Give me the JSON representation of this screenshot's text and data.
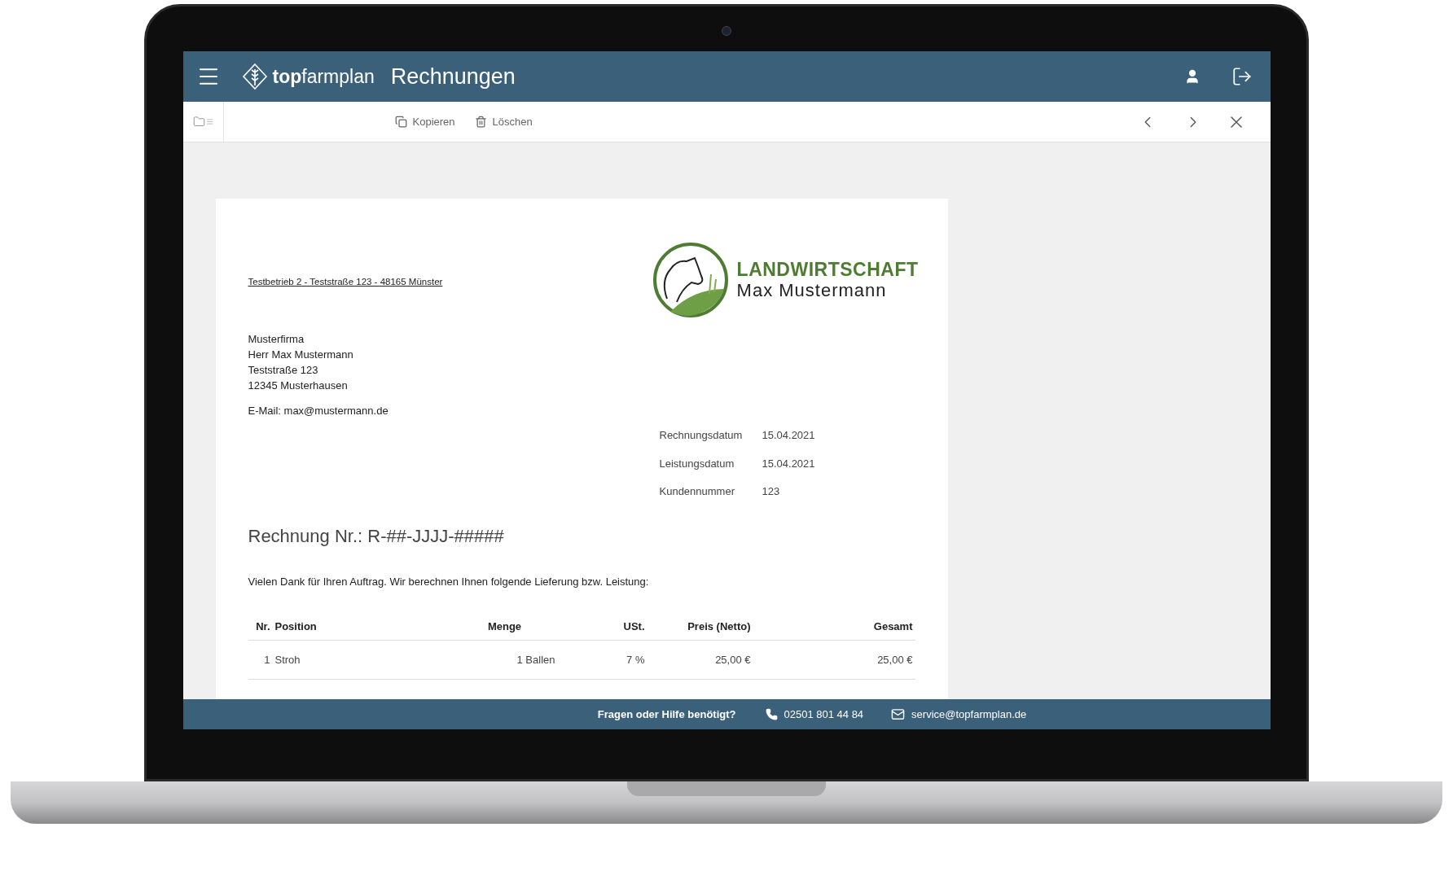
{
  "header": {
    "app_name": "**top**farmplan",
    "title": "Rechnungen"
  },
  "toolbar": {
    "actions": [
      {
        "label": "Kopieren",
        "kind": "copy"
      },
      {
        "label": "Löschen",
        "kind": "delete"
      }
    ]
  },
  "document": {
    "sender_line": "Testbetrieb 2 - Teststraße 123 - 48165 Münster",
    "logo": {
      "line_1": "LANDWIRTSCHAFT",
      "line_2": "Max Mustermann"
    },
    "recipient": [
      "Musterfirma",
      "Herr Max Mustermann",
      "Teststraße 123",
      "12345 Musterhausen"
    ],
    "email": "E-Mail: max@mustermann.de",
    "meta": [
      {
        "label": "Rechnungsdatum",
        "value": "15.04.2021"
      },
      {
        "label": "Leistungsdatum",
        "value": "15.04.2021"
      },
      {
        "label": "Kundennummer",
        "value": "123"
      }
    ],
    "title": "Rechnung Nr.: R-##-JJJJ-#####",
    "intro": "Vielen Dank für Ihren Auftrag. Wir berechnen Ihnen folgende Lieferung bzw. Leistung:",
    "table": {
      "columns": [
        "Nr.",
        "Position",
        "Menge",
        "USt.",
        "Preis (Netto)",
        "Gesamt"
      ],
      "rows": [
        [
          "1",
          "Stroh",
          "1 Ballen",
          "7 %",
          "25,00 €",
          "25,00 €"
        ]
      ]
    }
  },
  "footer": {
    "question": "Fragen oder Hilfe benötigt?",
    "phone": "02501 801 44 84",
    "email": "service@topfarmplan.de"
  }
}
